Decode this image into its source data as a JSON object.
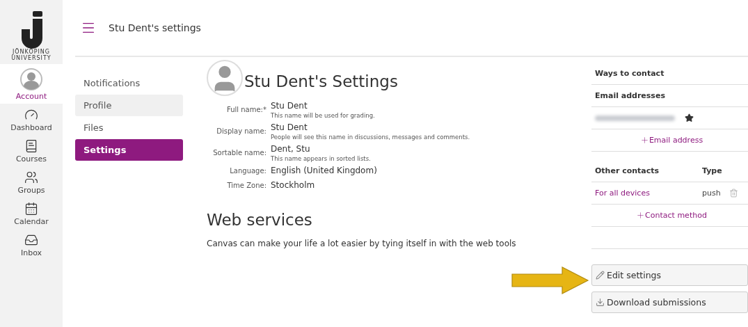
{
  "logo": {
    "line1": "JÖNKÖPING",
    "line2": "UNIVERSITY"
  },
  "global_nav": [
    {
      "label": "Account",
      "selected": true
    },
    {
      "label": "Dashboard",
      "selected": false
    },
    {
      "label": "Courses",
      "selected": false
    },
    {
      "label": "Groups",
      "selected": false
    },
    {
      "label": "Calendar",
      "selected": false
    },
    {
      "label": "Inbox",
      "selected": false
    }
  ],
  "header": {
    "title": "Stu Dent's settings"
  },
  "section_nav": [
    {
      "label": "Notifications",
      "selected": false,
      "hovered": false
    },
    {
      "label": "Profile",
      "selected": false,
      "hovered": true
    },
    {
      "label": "Files",
      "selected": false,
      "hovered": false
    },
    {
      "label": "Settings",
      "selected": true,
      "hovered": false
    }
  ],
  "page_title": "Stu Dent's Settings",
  "fields": [
    {
      "label": "Full name:*",
      "value": "Stu Dent",
      "hint": "This name will be used for grading."
    },
    {
      "label": "Display name:",
      "value": "Stu Dent",
      "hint": "People will see this name in discussions, messages and comments."
    },
    {
      "label": "Sortable name:",
      "value": "Dent, Stu",
      "hint": "This name appears in sorted lists."
    },
    {
      "label": "Language:",
      "value": "English (United Kingdom)"
    },
    {
      "label": "Time Zone:",
      "value": "Stockholm"
    }
  ],
  "web_services": {
    "heading": "Web services",
    "text": "Canvas can make your life a lot easier by tying itself in with the web tools"
  },
  "contact": {
    "heading": "Ways to contact",
    "email_heading": "Email addresses",
    "add_email": "Email address",
    "other_heading": "Other contacts",
    "type_heading": "Type",
    "others": [
      {
        "name": "For all devices",
        "type": "push"
      }
    ],
    "add_contact": "Contact method"
  },
  "actions": [
    {
      "kind": "edit",
      "label": "Edit settings"
    },
    {
      "kind": "download",
      "label": "Download submissions"
    }
  ]
}
